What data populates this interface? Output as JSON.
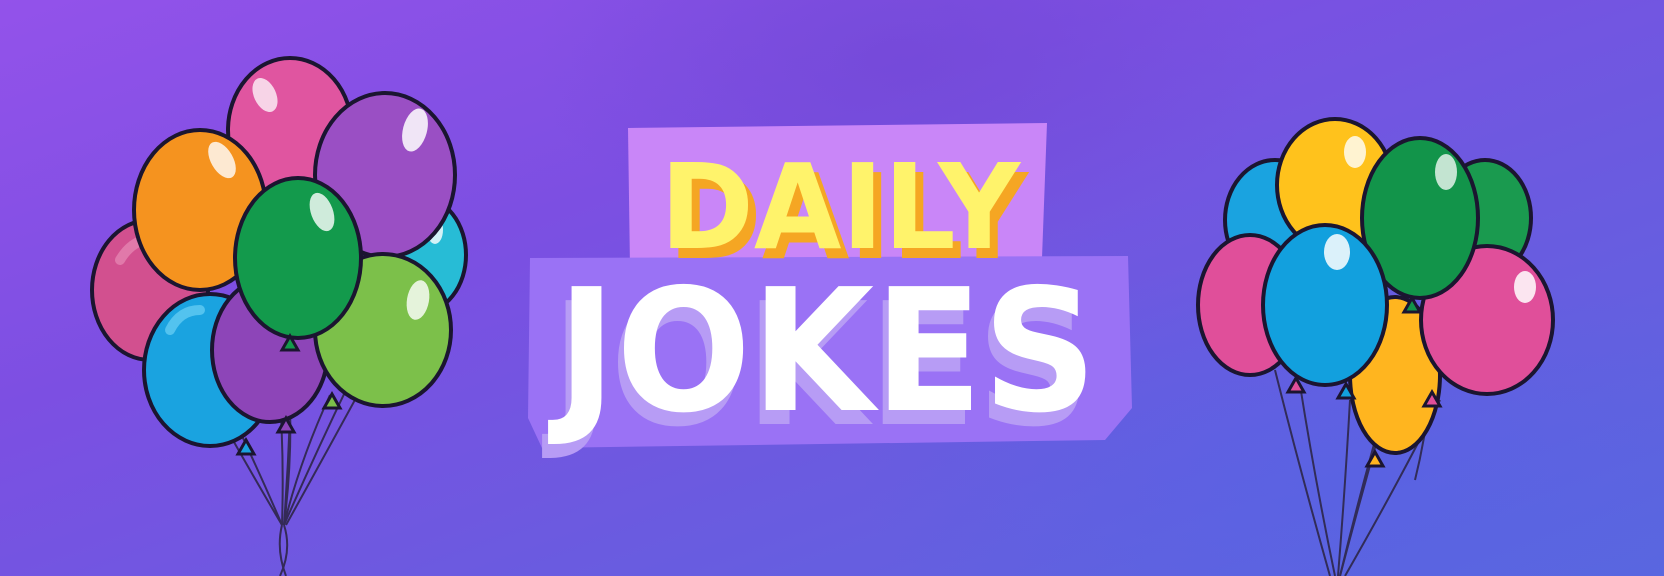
{
  "banner": {
    "title_line1": "DAILY",
    "title_line2": "JOKES"
  },
  "colors": {
    "title_line1_fill": "#fff36b",
    "title_line1_shadow": "#f5a623",
    "title_line2_fill": "#ffffff",
    "title_line2_shadow": "#b79cf5",
    "sticker_back_line1": "#c986f8",
    "sticker_back_line2": "#9a72f5",
    "outline": "#1b1530"
  },
  "icons": {
    "left_cluster": "balloon-bunch-icon",
    "right_cluster": "balloon-bunch-icon"
  }
}
